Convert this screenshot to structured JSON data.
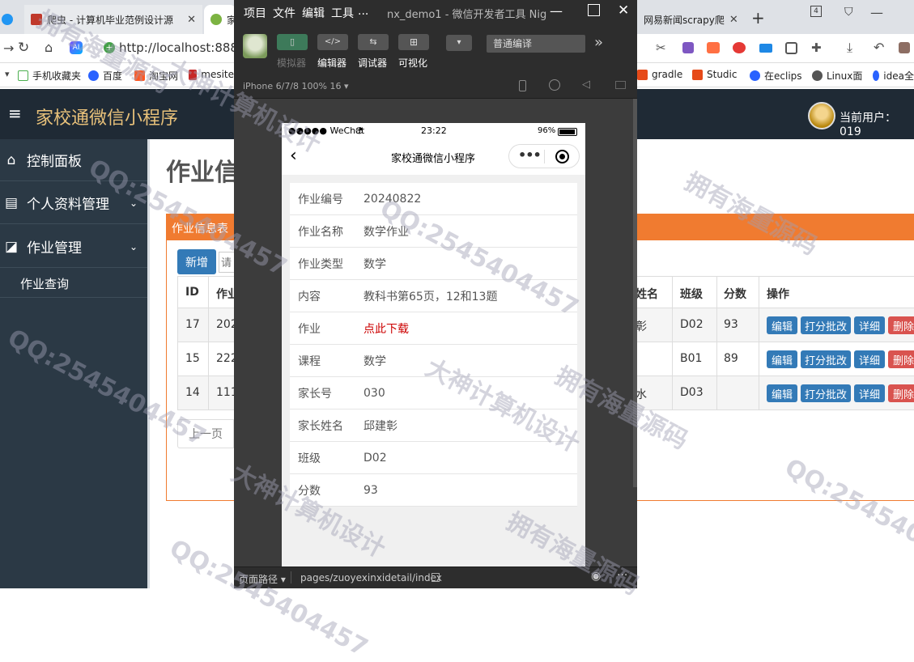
{
  "browser": {
    "tabs": [
      {
        "label": "爬虫 - 计算机毕业范例设计源",
        "color": "#c0392b"
      },
      {
        "label": "家",
        "color": "#7cb342"
      },
      {
        "label": "网易新闻scrapy爬",
        "color": "#e53935"
      }
    ],
    "new_tab_label": "+",
    "tab_count": "4",
    "address": "http://localhost:8888/",
    "bookmarks": [
      {
        "label": "手机收藏夹",
        "color": "#4caf50"
      },
      {
        "label": "百度",
        "color": "#2962ff"
      },
      {
        "label": "淘宝网",
        "color": "#ff5722"
      },
      {
        "label": "mesite",
        "color": "#c62828"
      },
      {
        "label": "gradle",
        "color": "#e64a19"
      },
      {
        "label": "Studic",
        "color": "#e64a19"
      },
      {
        "label": "在eclips",
        "color": "#2962ff"
      },
      {
        "label": "Linux面",
        "color": "#555"
      },
      {
        "label": "idea全",
        "color": "#2962ff"
      }
    ]
  },
  "admin": {
    "title": "家校通微信小程序",
    "current_user_label": "当前用户：019",
    "page_title": "作业信",
    "panel_title": "作业信息表",
    "add_button": "新增",
    "search_placeholder": "请",
    "sidebar": [
      {
        "label": "控制面板",
        "icon": "home-icon"
      },
      {
        "label": "个人资料管理",
        "icon": "list-icon"
      },
      {
        "label": "作业管理",
        "icon": "edit-icon"
      }
    ],
    "sidebar_sub": "作业查询",
    "table_headers": [
      "ID",
      "作业",
      "姓名",
      "班级",
      "分数",
      "操作"
    ],
    "rows": [
      {
        "id": "17",
        "code": "202",
        "name": "彰",
        "class": "D02",
        "score": "93"
      },
      {
        "id": "15",
        "code": "222",
        "name": "",
        "class": "B01",
        "score": "89"
      },
      {
        "id": "14",
        "code": "111",
        "name": "水",
        "class": "D03",
        "score": ""
      }
    ],
    "actions": [
      "编辑",
      "打分批改",
      "详细",
      "删除"
    ],
    "prev_page": "上一页"
  },
  "devtools": {
    "menu": [
      "项目",
      "文件",
      "编辑",
      "工具",
      "..."
    ],
    "title": "nx_demo1 - 微信开发者工具 Nig",
    "toolbar": [
      "模拟器",
      "编辑器",
      "调试器",
      "可视化"
    ],
    "compile_mode": "普通编译",
    "device": "iPhone 6/7/8 100% 16 ▾",
    "path_label": "页面路径 ▾",
    "path": "pages/zuoyexinxidetail/index"
  },
  "phone": {
    "carrier": "●●●●● WeChat",
    "time": "23:22",
    "battery": "96%",
    "nav_title": "家校通微信小程序",
    "fields": [
      {
        "label": "作业编号",
        "value": "20240822"
      },
      {
        "label": "作业名称",
        "value": "数学作业"
      },
      {
        "label": "作业类型",
        "value": "数学"
      },
      {
        "label": "内容",
        "value": "教科书第65页，12和13题"
      },
      {
        "label": "作业",
        "value": "点此下载",
        "link": true
      },
      {
        "label": "课程",
        "value": "数学"
      },
      {
        "label": "家长号",
        "value": "030"
      },
      {
        "label": "家长姓名",
        "value": "邱建彰"
      },
      {
        "label": "班级",
        "value": "D02"
      },
      {
        "label": "分数",
        "value": "93"
      }
    ]
  },
  "watermarks": [
    "拥有海量源码",
    "大神计算机设计",
    "QQ:2545404457",
    "QQ:254540457"
  ]
}
